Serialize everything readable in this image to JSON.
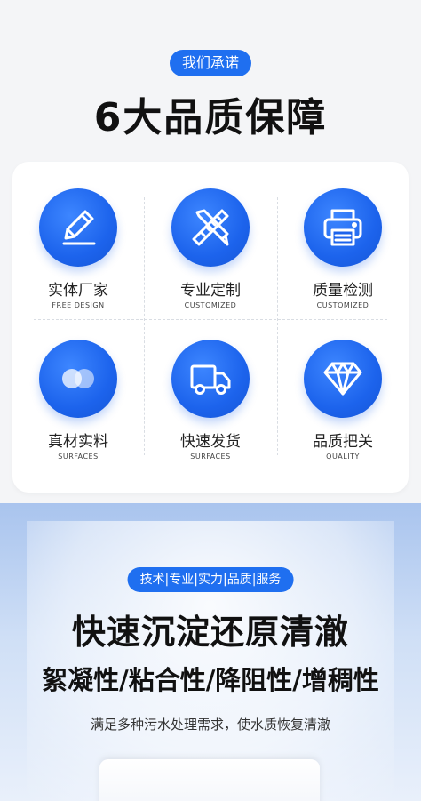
{
  "top": {
    "promise_label": "我们承诺",
    "title": "6大品质保障"
  },
  "features": [
    {
      "cn": "实体厂家",
      "en": "FREE DESIGN",
      "icon": "pencil-icon"
    },
    {
      "cn": "专业定制",
      "en": "CUSTOMIZED",
      "icon": "ruler-pencil-icon"
    },
    {
      "cn": "质量检测",
      "en": "CUSTOMIZED",
      "icon": "printer-icon"
    },
    {
      "cn": "真材实料",
      "en": "SURFACES",
      "icon": "circles-icon"
    },
    {
      "cn": "快速发货",
      "en": "SURFACES",
      "icon": "truck-icon"
    },
    {
      "cn": "品质把关",
      "en": "QUALITY",
      "icon": "diamond-icon"
    }
  ],
  "bottom": {
    "tags": "技术|专业|实力|品质|服务",
    "headline": "快速沉淀还原清澈",
    "subhead": "絮凝性/粘合性/降阻性/增稠性",
    "description": "满足多种污水处理需求，使水质恢复清澈"
  },
  "colors": {
    "accent": "#1f6ff0",
    "background": "#f4f5f7"
  }
}
